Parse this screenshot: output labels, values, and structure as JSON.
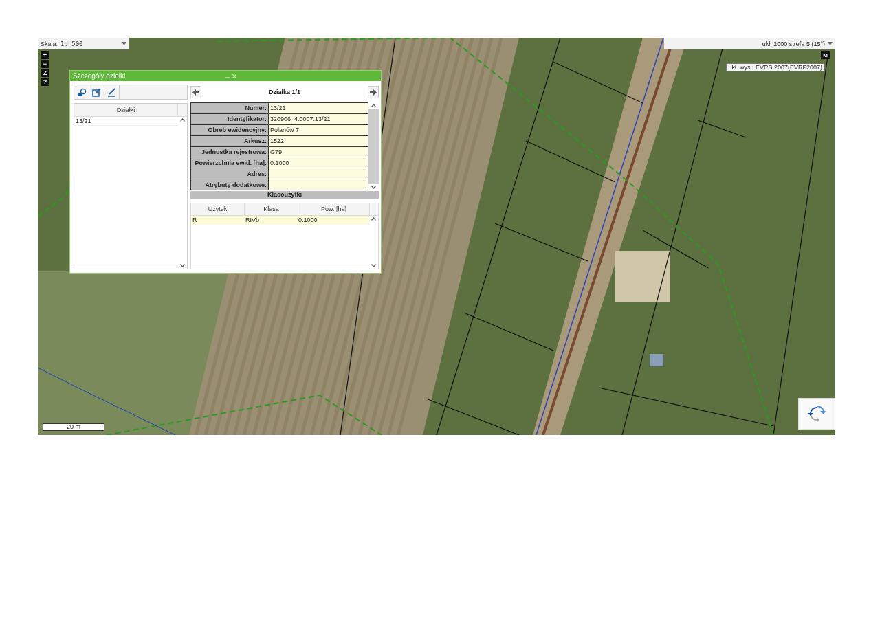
{
  "scale": {
    "label": "Skala:",
    "value": "1: 500"
  },
  "zoom_controls": [
    "+",
    "−",
    "Z",
    "?"
  ],
  "coordinate_system": "ukł. 2000 strefa 5 (15°)",
  "map_button": "M",
  "height_system": "ukł. wys.: EVRS 2007(EVRF2007)",
  "scale_bar": "20 m",
  "dialog": {
    "title": "Szczegóły działki",
    "list": {
      "header": "Działki",
      "items": [
        {
          "label": "13/21",
          "selected": false
        }
      ]
    },
    "detail_title": "Działka 1/1",
    "fields": [
      {
        "label": "Numer:",
        "value": "13/21"
      },
      {
        "label": "Identyfikator:",
        "value": "320906_4.0007.13/21"
      },
      {
        "label": "Obręb ewidencyjny:",
        "value": "Polanów 7"
      },
      {
        "label": "Arkusz:",
        "value": "1522"
      },
      {
        "label": "Jednostka rejestrowa:",
        "value": "G79"
      },
      {
        "label": "Powierzchnia ewid. [ha]:",
        "value": "0.1000"
      },
      {
        "label": "Adres:"
      },
      {
        "label": "Atrybuty dodatkowe:"
      }
    ],
    "section": "Klasoużytki",
    "columns": [
      "Użytek",
      "Klasa",
      "Pow. [ha]"
    ],
    "rows": [
      [
        "R",
        "RIVb",
        "0.1000"
      ]
    ]
  }
}
